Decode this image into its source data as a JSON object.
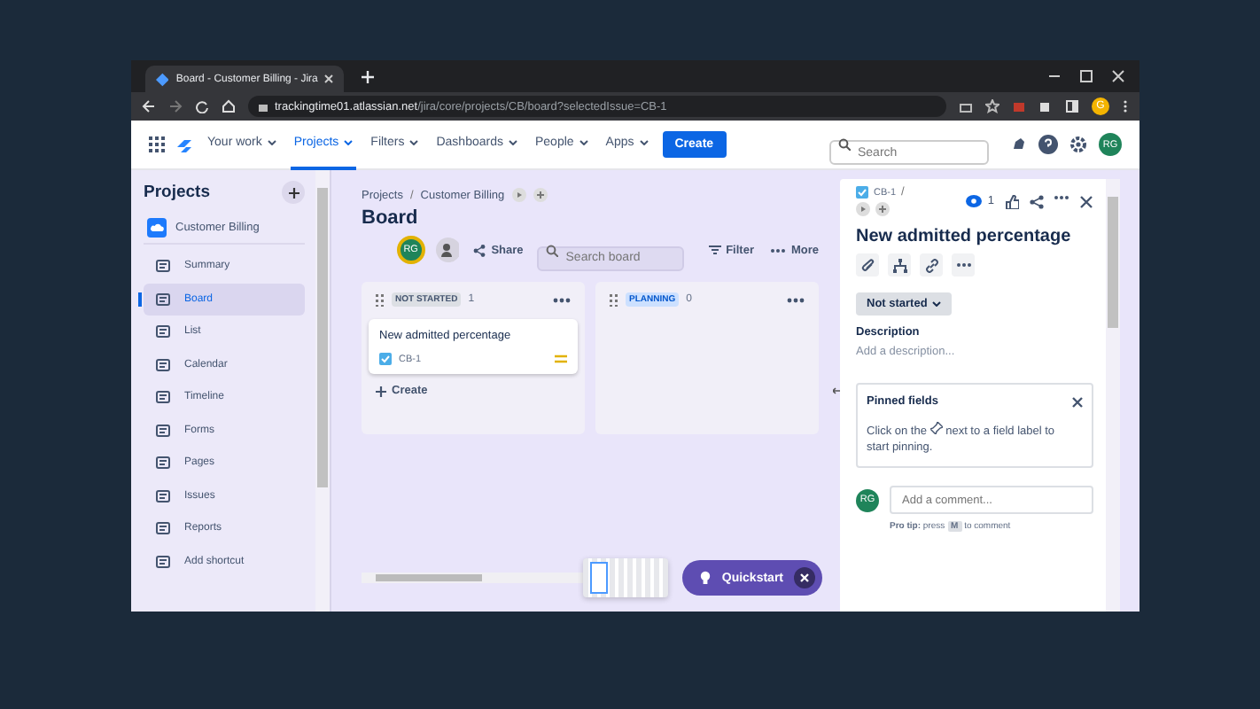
{
  "browser": {
    "tab_title": "Board - Customer Billing - Jira",
    "url_host": "trackingtime01.atlassian.net",
    "url_path": "/jira/core/projects/CB/board?selectedIssue=CB-1",
    "profile": "G"
  },
  "nav": {
    "items": [
      {
        "label": "Your work",
        "selected": false
      },
      {
        "label": "Projects",
        "selected": true
      },
      {
        "label": "Filters",
        "selected": false
      },
      {
        "label": "Dashboards",
        "selected": false
      },
      {
        "label": "People",
        "selected": false
      },
      {
        "label": "Apps",
        "selected": false
      }
    ],
    "create": "Create",
    "search_placeholder": "Search",
    "avatar": "RG"
  },
  "sidebar": {
    "title": "Projects",
    "project": "Customer Billing",
    "items": [
      {
        "label": "Summary",
        "selected": false
      },
      {
        "label": "Board",
        "selected": true
      },
      {
        "label": "List",
        "selected": false
      },
      {
        "label": "Calendar",
        "selected": false
      },
      {
        "label": "Timeline",
        "selected": false
      },
      {
        "label": "Forms",
        "selected": false
      },
      {
        "label": "Pages",
        "selected": false
      },
      {
        "label": "Issues",
        "selected": false
      },
      {
        "label": "Reports",
        "selected": false
      },
      {
        "label": "Add shortcut",
        "selected": false
      }
    ]
  },
  "board": {
    "breadcrumb": [
      "Projects",
      "Customer Billing"
    ],
    "breadcrumb_separator": "/",
    "title": "Board",
    "avatar": "RG",
    "share": "Share",
    "search_placeholder": "Search board",
    "filter": "Filter",
    "more": "More",
    "columns": [
      {
        "name": "NOT STARTED",
        "count": "1",
        "cards": [
          {
            "title": "New admitted percentage",
            "key": "CB-1"
          }
        ],
        "create": "Create"
      },
      {
        "name": "PLANNING",
        "count": "0"
      }
    ]
  },
  "detail": {
    "key": "CB-1",
    "key_separator": "/",
    "watchers": "1",
    "title": "New admitted percentage",
    "status": "Not started",
    "description_label": "Description",
    "description_placeholder": "Add a description...",
    "pinned_title": "Pinned fields",
    "pinned_before": "Click on the",
    "pinned_after": "next to a field label to",
    "pinned_end": "start pinning.",
    "comment_avatar": "RG",
    "comment_placeholder": "Add a comment...",
    "tip_label": "Pro tip:",
    "tip_before": "press",
    "tip_key": "M",
    "tip_after": "to comment"
  },
  "quickstart": "Quickstart"
}
